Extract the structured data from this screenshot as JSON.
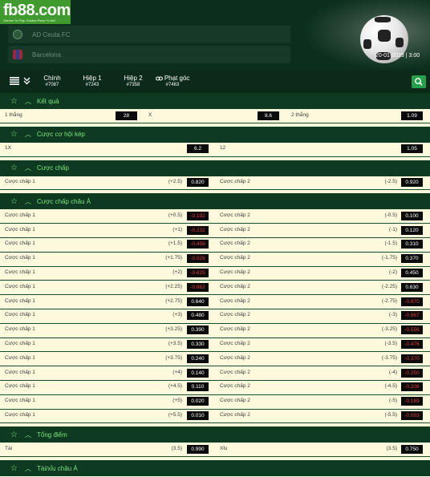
{
  "brand": {
    "logo": "fb88.com",
    "tagline": "Games To Play  Trusted Place To Bet"
  },
  "match": {
    "home": "AD Ceuta FC",
    "away": "Barcelona",
    "datetime": "20-01-2023 | 3:00"
  },
  "tabs": [
    {
      "label": "Chính",
      "count": "#7087"
    },
    {
      "label": "Hiệp 1",
      "count": "#7243"
    },
    {
      "label": "Hiệp 2",
      "count": "#7358"
    },
    {
      "label": "Phạt góc",
      "count": "#7463"
    }
  ],
  "result": {
    "title": "Kết quả",
    "home_label": "1 thắng",
    "home_odd": "28",
    "draw_label": "X",
    "draw_odd": "8.6",
    "away_label": "2 thắng",
    "away_odd": "1.09"
  },
  "double_chance": {
    "title": "Cược cơ hội kép",
    "left_label": "1X",
    "left_odd": "6.2",
    "right_label": "12",
    "right_odd": "1.05"
  },
  "handicap": {
    "title": "Cược chấp",
    "rows": [
      {
        "l_label": "Cược chấp 1",
        "l_hcp": "(+2.5)",
        "l_odd": "0.820",
        "r_label": "Cược chấp 2",
        "r_hcp": "(-2.5)",
        "r_odd": "0.920"
      }
    ]
  },
  "asian_handicap": {
    "title": "Cược chấp châu Á",
    "rows": [
      {
        "l_label": "Cược chấp 1",
        "l_hcp": "(+0.5)",
        "l_odd": "-0.192",
        "r_label": "Cược chấp 2",
        "r_hcp": "(-0.5)",
        "r_odd": "0.100"
      },
      {
        "l_label": "Cược chấp 1",
        "l_hcp": "(+1)",
        "l_odd": "-0.232",
        "r_label": "Cược chấp 2",
        "r_hcp": "(-1)",
        "r_odd": "0.120"
      },
      {
        "l_label": "Cược chấp 1",
        "l_hcp": "(+1.5)",
        "l_odd": "-0.456",
        "r_label": "Cược chấp 2",
        "r_hcp": "(-1.5)",
        "r_odd": "0.310"
      },
      {
        "l_label": "Cược chấp 1",
        "l_hcp": "(+1.75)",
        "l_odd": "-0.526",
        "r_label": "Cược chấp 2",
        "r_hcp": "(-1.75)",
        "r_odd": "0.370"
      },
      {
        "l_label": "Cược chấp 1",
        "l_hcp": "(+2)",
        "l_odd": "-0.625",
        "r_label": "Cược chấp 2",
        "r_hcp": "(-2)",
        "r_odd": "0.450"
      },
      {
        "l_label": "Cược chấp 1",
        "l_hcp": "(+2.25)",
        "l_odd": "-0.862",
        "r_label": "Cược chấp 2",
        "r_hcp": "(-2.25)",
        "r_odd": "0.630"
      },
      {
        "l_label": "Cược chấp 1",
        "l_hcp": "(+2.75)",
        "l_odd": "0.640",
        "r_label": "Cược chấp 2",
        "r_hcp": "(-2.75)",
        "r_odd": "-0.870"
      },
      {
        "l_label": "Cược chấp 1",
        "l_hcp": "(+3)",
        "l_odd": "0.480",
        "r_label": "Cược chấp 2",
        "r_hcp": "(-3)",
        "r_odd": "-0.667"
      },
      {
        "l_label": "Cược chấp 1",
        "l_hcp": "(+3.25)",
        "l_odd": "0.390",
        "r_label": "Cược chấp 2",
        "r_hcp": "(-3.25)",
        "r_odd": "-0.556"
      },
      {
        "l_label": "Cược chấp 1",
        "l_hcp": "(+3.5)",
        "l_odd": "0.330",
        "r_label": "Cược chấp 2",
        "r_hcp": "(-3.5)",
        "r_odd": "-0.476"
      },
      {
        "l_label": "Cược chấp 1",
        "l_hcp": "(+3.75)",
        "l_odd": "0.240",
        "r_label": "Cược chấp 2",
        "r_hcp": "(-3.75)",
        "r_odd": "-0.370"
      },
      {
        "l_label": "Cược chấp 1",
        "l_hcp": "(+4)",
        "l_odd": "0.140",
        "r_label": "Cược chấp 2",
        "r_hcp": "(-4)",
        "r_odd": "-0.250"
      },
      {
        "l_label": "Cược chấp 1",
        "l_hcp": "(+4.5)",
        "l_odd": "0.110",
        "r_label": "Cược chấp 2",
        "r_hcp": "(-4.5)",
        "r_odd": "-0.208"
      },
      {
        "l_label": "Cược chấp 1",
        "l_hcp": "(+5)",
        "l_odd": "0.020",
        "r_label": "Cược chấp 2",
        "r_hcp": "(-5)",
        "r_odd": "-0.169"
      },
      {
        "l_label": "Cược chấp 1",
        "l_hcp": "(+5.5)",
        "l_odd": "0.010",
        "r_label": "Cược chấp 2",
        "r_hcp": "(-5.5)",
        "r_odd": "-0.093"
      }
    ]
  },
  "total": {
    "title": "Tổng điểm",
    "rows": [
      {
        "l_label": "Tài",
        "l_hcp": "(3.5)",
        "l_odd": "0.990",
        "r_label": "Xỉu",
        "r_hcp": "(3.5)",
        "r_odd": "0.750"
      }
    ]
  },
  "asian_total": {
    "title": "Tài/xỉu châu Á"
  },
  "colors": {
    "header_bg": "#0c2e1c",
    "section_bg": "#0f3a22",
    "section_text": "#7de37d",
    "row_bg": "#fdf9dd",
    "odd_box": "#0a0a0a",
    "negative_odd": "#e23a3a",
    "accent_green": "#27a04b"
  },
  "icons": [
    "menu-list-icon",
    "double-chevron-icon",
    "link-icon",
    "search-icon",
    "star-icon",
    "chevron-up-icon",
    "soccer-ball-icon"
  ]
}
